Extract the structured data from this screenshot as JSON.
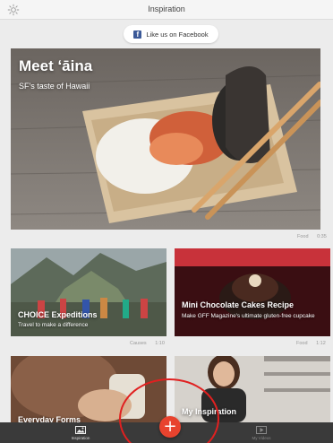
{
  "header": {
    "title": "Inspiration",
    "settings_icon": "gear-icon"
  },
  "facebook": {
    "label": "Like us on Facebook",
    "icon": "facebook-icon",
    "glyph": "f"
  },
  "hero": {
    "title": "Meet ʻāina",
    "subtitle": "SF's taste of Hawaii",
    "category": "Food",
    "duration": "0:35"
  },
  "cards": [
    {
      "title": "CHOICE Expeditions",
      "subtitle": "Travel to make a difference",
      "category": "Causes",
      "duration": "1:10"
    },
    {
      "title": "Mini Chocolate Cakes Recipe",
      "subtitle": "Make GFF Magazine's ultimate gluten-free cupcake",
      "category": "Food",
      "duration": "1:12"
    },
    {
      "title": "Everyday Forms",
      "subtitle": ""
    },
    {
      "title": "My Inspiration",
      "subtitle": ""
    }
  ],
  "tabbar": {
    "tabs": [
      {
        "label": "Inspiration",
        "icon": "image-icon",
        "active": true
      },
      {
        "label": "My Videos",
        "icon": "play-icon",
        "active": false
      }
    ],
    "add": {
      "icon": "plus-icon",
      "glyph": "+"
    }
  },
  "colors": {
    "accent": "#e8432e",
    "facebook": "#3b5998",
    "tabbar": "#3a3a3a"
  }
}
